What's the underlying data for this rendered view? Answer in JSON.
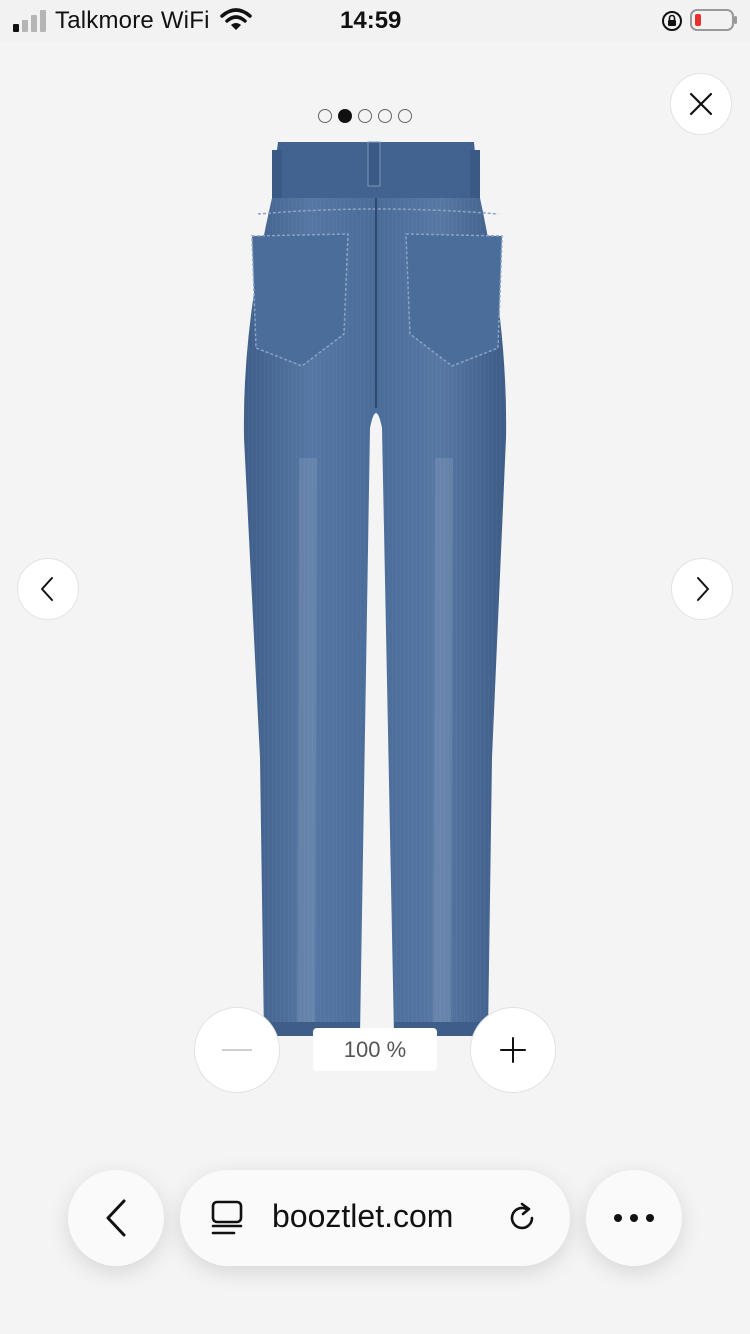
{
  "status_bar": {
    "carrier": "Talkmore WiFi",
    "time": "14:59",
    "signal_bars_active": 1,
    "battery_color": "#e8312f"
  },
  "gallery": {
    "image_count": 5,
    "active_index": 1,
    "image_alt": "jeans-back-view",
    "zoom_level": "100 %"
  },
  "icons": {
    "close": "close-icon",
    "prev": "chevron-left-icon",
    "next": "chevron-right-icon",
    "zoom_out": "minus-icon",
    "zoom_in": "plus-icon",
    "back": "chevron-left-icon",
    "tabs": "tabs-icon",
    "reload": "reload-icon",
    "more": "more-dots-icon"
  },
  "browser": {
    "url": "booztlet.com"
  },
  "colors": {
    "denim": "#4a6c99",
    "background": "#f4f4f4"
  }
}
